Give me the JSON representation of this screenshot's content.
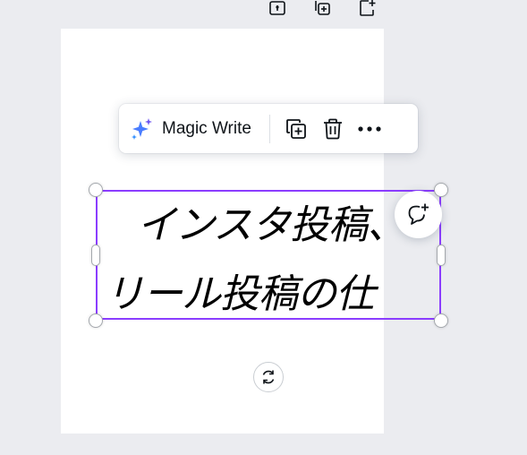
{
  "top_toolbar": {
    "icons": [
      "lock-icon",
      "duplicate-page-icon",
      "add-page-icon"
    ]
  },
  "element_toolbar": {
    "magic_write_label": "Magic Write",
    "icons": [
      "magic-write-sparkle-icon",
      "duplicate-icon",
      "delete-icon",
      "more-options-icon"
    ]
  },
  "text_element": {
    "line1": "インスタ投稿、",
    "line2": "リール投稿の仕"
  },
  "floating_controls": {
    "icons": [
      "add-comment-icon",
      "rotate-icon"
    ]
  },
  "colors": {
    "canvas_background": "#ebecf0",
    "page_background": "#ffffff",
    "selection_border": "#8b3dff",
    "sparkle_primary": "#4a7dff",
    "sparkle_secondary": "#6e55f0",
    "icon_color": "#0e1318"
  }
}
